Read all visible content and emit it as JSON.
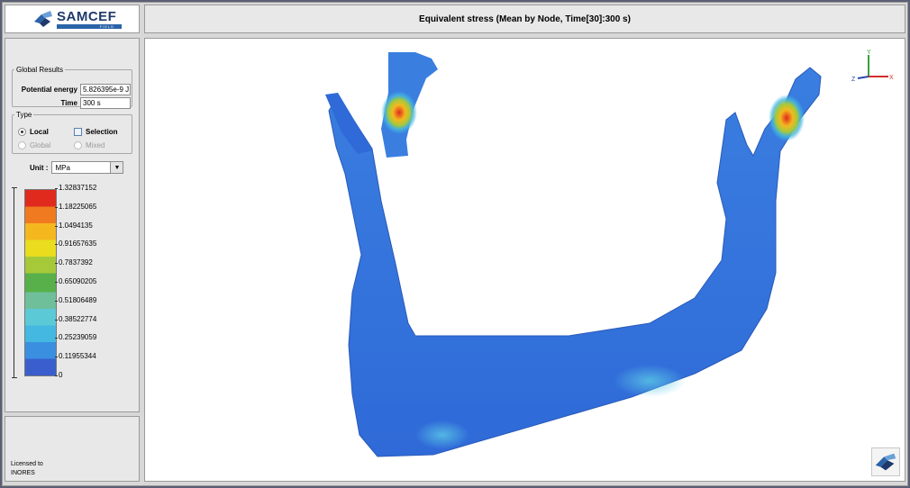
{
  "brand": {
    "name": "SAMCEF",
    "sub": "FIELD"
  },
  "title": "Equivalent stress (Mean by Node, Time[30]:300 s)",
  "global_results": {
    "legend": "Global Results",
    "potential_energy_label": "Potential energy",
    "potential_energy_value": "5.826395e-9 J",
    "time_label": "Time",
    "time_value": "300 s"
  },
  "type_group": {
    "legend": "Type",
    "options": [
      {
        "label": "Local",
        "selected": true,
        "enabled": true
      },
      {
        "label": "Selection",
        "checked": false,
        "enabled": true
      },
      {
        "label": "Global",
        "selected": false,
        "enabled": false
      },
      {
        "label": "Mixed",
        "selected": false,
        "enabled": false
      }
    ]
  },
  "unit": {
    "label": "Unit :",
    "value": "MPa"
  },
  "color_legend": {
    "ticks": [
      "1.32837152",
      "1.18225065",
      "1.0494135",
      "0.91657635",
      "0.7837392",
      "0.65090205",
      "0.51806489",
      "0.38522774",
      "0.25239059",
      "0.11955344",
      "0"
    ],
    "colors": [
      "#e02a1e",
      "#f07a20",
      "#f4b81e",
      "#e9dd1e",
      "#a6c93a",
      "#58b04a",
      "#6fbf9a",
      "#5cc9d6",
      "#44b8e0",
      "#3a8fe0",
      "#3a5fcd"
    ]
  },
  "license": {
    "line1": "Licensed to",
    "line2": "INORES"
  },
  "axes": {
    "x": "X",
    "y": "Y",
    "z": "Z"
  }
}
